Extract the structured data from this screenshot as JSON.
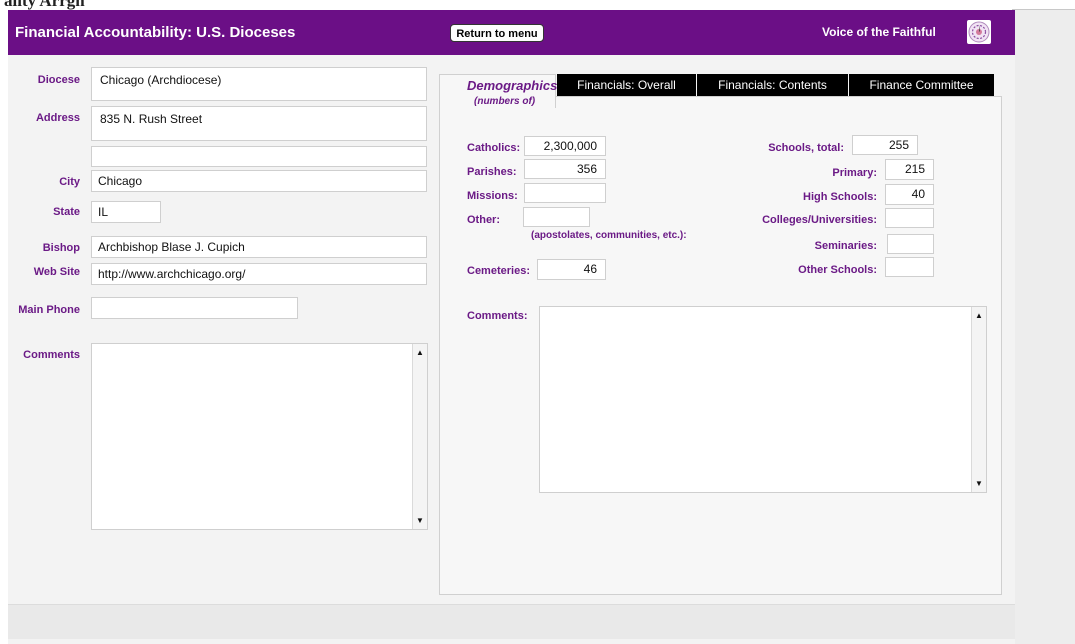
{
  "page_top_fragment": "ality Arrgh",
  "header": {
    "title": "Financial Accountability: U.S. Dioceses",
    "return_button": "Return to menu",
    "org_name": "Voice of the Faithful",
    "logo_icon": "voice-of-the-faithful-logo-icon"
  },
  "colors": {
    "brand_purple": "#6b0f86",
    "label_purple": "#6b1a86"
  },
  "left": {
    "diocese_label": "Diocese",
    "diocese_value": "Chicago (Archdiocese)",
    "address_label": "Address",
    "address_line1": "835 N. Rush Street",
    "address_line2": "",
    "city_label": "City",
    "city_value": "Chicago",
    "state_label": "State",
    "state_value": "IL",
    "bishop_label": "Bishop",
    "bishop_value": "Archbishop Blase J. Cupich",
    "website_label": "Web Site",
    "website_value": "http://www.archchicago.org/",
    "phone_label": "Main Phone",
    "phone_value": "",
    "comments_label": "Comments",
    "comments_value": ""
  },
  "tabs": [
    {
      "label": "Demographics",
      "active": true
    },
    {
      "label": "Financials: Overall",
      "active": false
    },
    {
      "label": "Financials: Contents",
      "active": false
    },
    {
      "label": "Finance Committee",
      "active": false
    }
  ],
  "demographics": {
    "subtitle": "(numbers of)",
    "catholics_label": "Catholics:",
    "catholics_value": "2,300,000",
    "parishes_label": "Parishes:",
    "parishes_value": "356",
    "missions_label": "Missions:",
    "missions_value": "",
    "other_label": "Other:",
    "other_value": "",
    "other_note": "(apostolates, communities, etc.):",
    "cemeteries_label": "Cemeteries:",
    "cemeteries_value": "46",
    "schools_total_label": "Schools, total:",
    "schools_total_value": "255",
    "primary_label": "Primary:",
    "primary_value": "215",
    "high_schools_label": "High Schools:",
    "high_schools_value": "40",
    "colleges_label": "Colleges/Universities:",
    "colleges_value": "",
    "seminaries_label": "Seminaries:",
    "seminaries_value": "",
    "other_schools_label": "Other Schools:",
    "other_schools_value": "",
    "comments_label": "Comments:",
    "comments_value": ""
  },
  "scroll_icons": {
    "up": "▲",
    "down": "▼"
  }
}
